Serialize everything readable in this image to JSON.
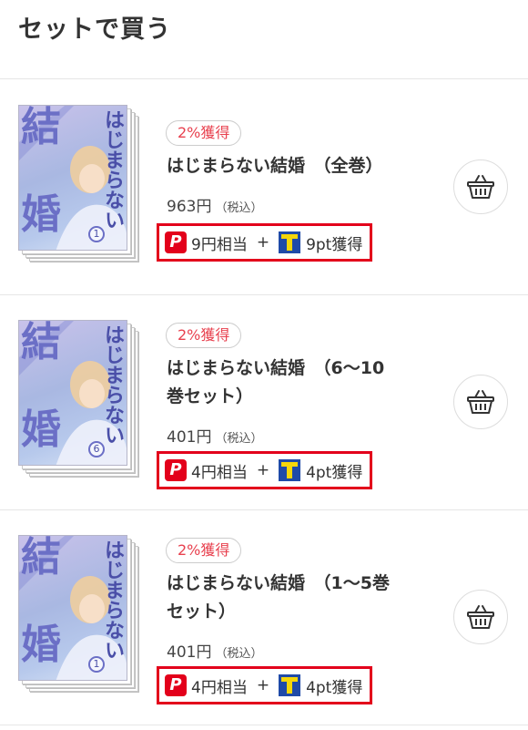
{
  "header": {
    "title": "セットで買う"
  },
  "items": [
    {
      "badge": "2%獲得",
      "title_line1": "はじまらない結婚　（全巻）",
      "title_line2": "",
      "price": "963円",
      "tax": "（税込）",
      "paypay_points": "9円相当",
      "plus": "+",
      "tpoints": "9pt獲得",
      "cover": {
        "title_top": "結",
        "title_bottom": "婚",
        "vertical": "はじまらない",
        "volume": "1"
      }
    },
    {
      "badge": "2%獲得",
      "title_line1": "はじまらない結婚　（6～10",
      "title_line2": "巻セット）",
      "price": "401円",
      "tax": "（税込）",
      "paypay_points": "4円相当",
      "plus": "+",
      "tpoints": "4pt獲得",
      "cover": {
        "title_top": "結",
        "title_bottom": "婚",
        "vertical": "はじまらない",
        "volume": "6"
      }
    },
    {
      "badge": "2%獲得",
      "title_line1": "はじまらない結婚　（1～5巻",
      "title_line2": "セット）",
      "price": "401円",
      "tax": "（税込）",
      "paypay_points": "4円相当",
      "plus": "+",
      "tpoints": "4pt獲得",
      "cover": {
        "title_top": "結",
        "title_bottom": "婚",
        "vertical": "はじまらない",
        "volume": "1"
      }
    }
  ],
  "icons": {
    "paypay": "paypay-icon",
    "tpoint": "tpoint-icon",
    "cart": "basket-icon"
  },
  "colors": {
    "accent_red": "#e3001b",
    "badge_text": "#e8414f",
    "tpoint_blue": "#1f4aa8",
    "tpoint_yellow": "#f5d60a"
  }
}
